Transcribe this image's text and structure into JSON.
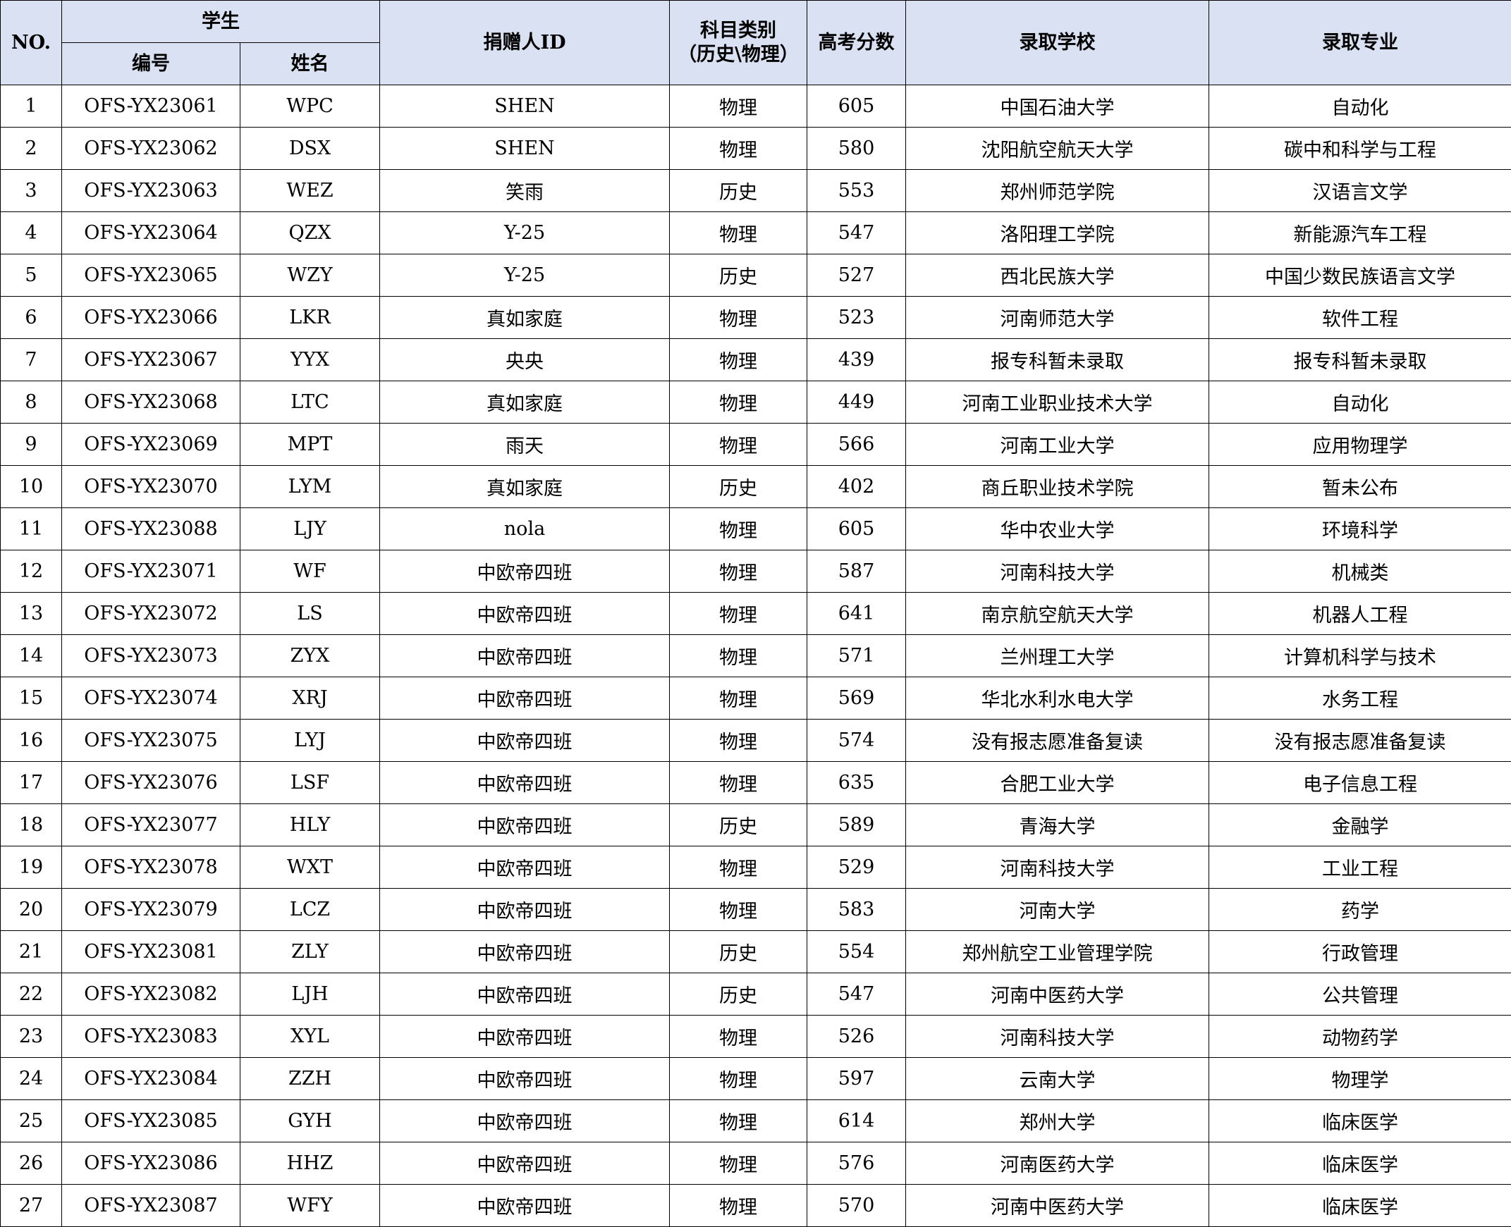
{
  "headers": {
    "no": "NO.",
    "student_group": "学生",
    "student_id": "编号",
    "student_name": "姓名",
    "donor_id": "捐赠人ID",
    "subject_line1": "科目类别",
    "subject_line2": "（历史\\物理）",
    "score": "高考分数",
    "school": "录取学校",
    "major": "录取专业"
  },
  "rows": [
    {
      "no": "1",
      "id": "OFS-YX23061",
      "name": "WPC",
      "donor": "SHEN",
      "subject": "物理",
      "score": "605",
      "school": "中国石油大学",
      "major": "自动化"
    },
    {
      "no": "2",
      "id": "OFS-YX23062",
      "name": "DSX",
      "donor": "SHEN",
      "subject": "物理",
      "score": "580",
      "school": "沈阳航空航天大学",
      "major": "碳中和科学与工程"
    },
    {
      "no": "3",
      "id": "OFS-YX23063",
      "name": "WEZ",
      "donor": "笑雨",
      "subject": "历史",
      "score": "553",
      "school": "郑州师范学院",
      "major": "汉语言文学"
    },
    {
      "no": "4",
      "id": "OFS-YX23064",
      "name": "QZX",
      "donor": "Y-25",
      "subject": "物理",
      "score": "547",
      "school": "洛阳理工学院",
      "major": "新能源汽车工程"
    },
    {
      "no": "5",
      "id": "OFS-YX23065",
      "name": "WZY",
      "donor": "Y-25",
      "subject": "历史",
      "score": "527",
      "school": "西北民族大学",
      "major": "中国少数民族语言文学"
    },
    {
      "no": "6",
      "id": "OFS-YX23066",
      "name": "LKR",
      "donor": "真如家庭",
      "subject": "物理",
      "score": "523",
      "school": "河南师范大学",
      "major": "软件工程"
    },
    {
      "no": "7",
      "id": "OFS-YX23067",
      "name": "YYX",
      "donor": "央央",
      "subject": "物理",
      "score": "439",
      "school": "报专科暂未录取",
      "major": "报专科暂未录取"
    },
    {
      "no": "8",
      "id": "OFS-YX23068",
      "name": "LTC",
      "donor": "真如家庭",
      "subject": "物理",
      "score": "449",
      "school": "河南工业职业技术大学",
      "major": "自动化"
    },
    {
      "no": "9",
      "id": "OFS-YX23069",
      "name": "MPT",
      "donor": "雨天",
      "subject": "物理",
      "score": "566",
      "school": "河南工业大学",
      "major": "应用物理学"
    },
    {
      "no": "10",
      "id": "OFS-YX23070",
      "name": "LYM",
      "donor": "真如家庭",
      "subject": "历史",
      "score": "402",
      "school": "商丘职业技术学院",
      "major": "暂未公布"
    },
    {
      "no": "11",
      "id": "OFS-YX23088",
      "name": "LJY",
      "donor": "nola",
      "subject": "物理",
      "score": "605",
      "school": "华中农业大学",
      "major": "环境科学"
    },
    {
      "no": "12",
      "id": "OFS-YX23071",
      "name": "WF",
      "donor": "中欧帝四班",
      "subject": "物理",
      "score": "587",
      "school": "河南科技大学",
      "major": "机械类"
    },
    {
      "no": "13",
      "id": "OFS-YX23072",
      "name": "LS",
      "donor": "中欧帝四班",
      "subject": "物理",
      "score": "641",
      "school": "南京航空航天大学",
      "major": "机器人工程"
    },
    {
      "no": "14",
      "id": "OFS-YX23073",
      "name": "ZYX",
      "donor": "中欧帝四班",
      "subject": "物理",
      "score": "571",
      "school": "兰州理工大学",
      "major": "计算机科学与技术"
    },
    {
      "no": "15",
      "id": "OFS-YX23074",
      "name": "XRJ",
      "donor": "中欧帝四班",
      "subject": "物理",
      "score": "569",
      "school": "华北水利水电大学",
      "major": "水务工程"
    },
    {
      "no": "16",
      "id": "OFS-YX23075",
      "name": "LYJ",
      "donor": "中欧帝四班",
      "subject": "物理",
      "score": "574",
      "school": "没有报志愿准备复读",
      "major": "没有报志愿准备复读"
    },
    {
      "no": "17",
      "id": "OFS-YX23076",
      "name": "LSF",
      "donor": "中欧帝四班",
      "subject": "物理",
      "score": "635",
      "school": "合肥工业大学",
      "major": "电子信息工程"
    },
    {
      "no": "18",
      "id": "OFS-YX23077",
      "name": "HLY",
      "donor": "中欧帝四班",
      "subject": "历史",
      "score": "589",
      "school": "青海大学",
      "major": "金融学"
    },
    {
      "no": "19",
      "id": "OFS-YX23078",
      "name": "WXT",
      "donor": "中欧帝四班",
      "subject": "物理",
      "score": "529",
      "school": "河南科技大学",
      "major": "工业工程"
    },
    {
      "no": "20",
      "id": "OFS-YX23079",
      "name": "LCZ",
      "donor": "中欧帝四班",
      "subject": "物理",
      "score": "583",
      "school": "河南大学",
      "major": "药学"
    },
    {
      "no": "21",
      "id": "OFS-YX23081",
      "name": "ZLY",
      "donor": "中欧帝四班",
      "subject": "历史",
      "score": "554",
      "school": "郑州航空工业管理学院",
      "major": "行政管理"
    },
    {
      "no": "22",
      "id": "OFS-YX23082",
      "name": "LJH",
      "donor": "中欧帝四班",
      "subject": "历史",
      "score": "547",
      "school": "河南中医药大学",
      "major": "公共管理"
    },
    {
      "no": "23",
      "id": "OFS-YX23083",
      "name": "XYL",
      "donor": "中欧帝四班",
      "subject": "物理",
      "score": "526",
      "school": "河南科技大学",
      "major": "动物药学"
    },
    {
      "no": "24",
      "id": "OFS-YX23084",
      "name": "ZZH",
      "donor": "中欧帝四班",
      "subject": "物理",
      "score": "597",
      "school": "云南大学",
      "major": "物理学"
    },
    {
      "no": "25",
      "id": "OFS-YX23085",
      "name": "GYH",
      "donor": "中欧帝四班",
      "subject": "物理",
      "score": "614",
      "school": "郑州大学",
      "major": "临床医学"
    },
    {
      "no": "26",
      "id": "OFS-YX23086",
      "name": "HHZ",
      "donor": "中欧帝四班",
      "subject": "物理",
      "score": "576",
      "school": "河南医药大学",
      "major": "临床医学"
    },
    {
      "no": "27",
      "id": "OFS-YX23087",
      "name": "WFY",
      "donor": "中欧帝四班",
      "subject": "物理",
      "score": "570",
      "school": "河南中医药大学",
      "major": "临床医学"
    }
  ]
}
